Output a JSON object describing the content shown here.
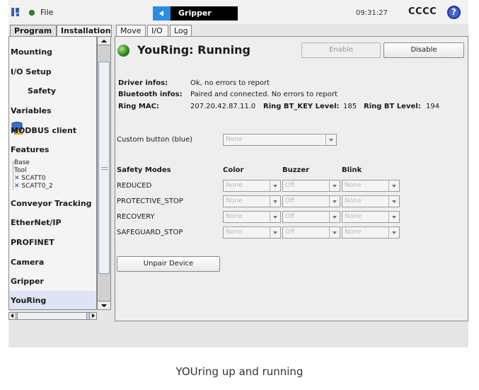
{
  "header": {
    "file_menu": "File",
    "program_name": "Gripper",
    "clock": "09:31:27",
    "robot_name": "CCCC",
    "help_label": "?"
  },
  "tabs": [
    {
      "label": "Program"
    },
    {
      "label": "Installation"
    },
    {
      "label": "Move"
    },
    {
      "label": "I/O"
    },
    {
      "label": "Log"
    }
  ],
  "sidebar": {
    "items": [
      {
        "label": "Mounting"
      },
      {
        "label": "I/O Setup"
      },
      {
        "label": "Safety"
      },
      {
        "label": "Variables"
      },
      {
        "label": "MODBUS client"
      },
      {
        "label": "Features"
      },
      {
        "label": "Conveyor Tracking"
      },
      {
        "label": "EtherNet/IP"
      },
      {
        "label": "PROFINET"
      },
      {
        "label": "Camera"
      },
      {
        "label": "Gripper"
      },
      {
        "label": "YouRing"
      }
    ],
    "features": [
      "Base",
      "Tool",
      "SCATT0",
      "SCATT0_2"
    ],
    "selected": "YouRing"
  },
  "main": {
    "title": "YouRing: Running",
    "enable_label": "Enable",
    "disable_label": "Disable",
    "driver_label": "Driver infos:",
    "driver_value": "Ok, no errors to report",
    "bluetooth_label": "Bluetooth infos:",
    "bluetooth_value": "Paired and connected. No errors to report",
    "mac_label": "Ring MAC:",
    "mac_value": "207.20.42.87.11.0",
    "btkey_label": "Ring BT_KEY Level:",
    "btkey_value": "185",
    "btlevel_label": "Ring BT Level:",
    "btlevel_value": "194",
    "custom_button_label": "Custom button (blue)",
    "custom_button_value": "None",
    "safety_header": "Safety Modes",
    "color_header": "Color",
    "buzzer_header": "Buzzer",
    "blink_header": "Blink",
    "modes": [
      {
        "name": "REDUCED",
        "color": "None",
        "buzzer": "Off",
        "blink": "None"
      },
      {
        "name": "PROTECTIVE_STOP",
        "color": "None",
        "buzzer": "Off",
        "blink": "None"
      },
      {
        "name": "RECOVERY",
        "color": "None",
        "buzzer": "Off",
        "blink": "None"
      },
      {
        "name": "SAFEGUARD_STOP",
        "color": "None",
        "buzzer": "Off",
        "blink": "None"
      }
    ],
    "unpair_label": "Unpair Device"
  },
  "caption": "YOUring up and running",
  "colors": {
    "accent": "#2a8de0",
    "status_green": "#2e8a1e",
    "selected_bg": "#dfe4f5"
  }
}
